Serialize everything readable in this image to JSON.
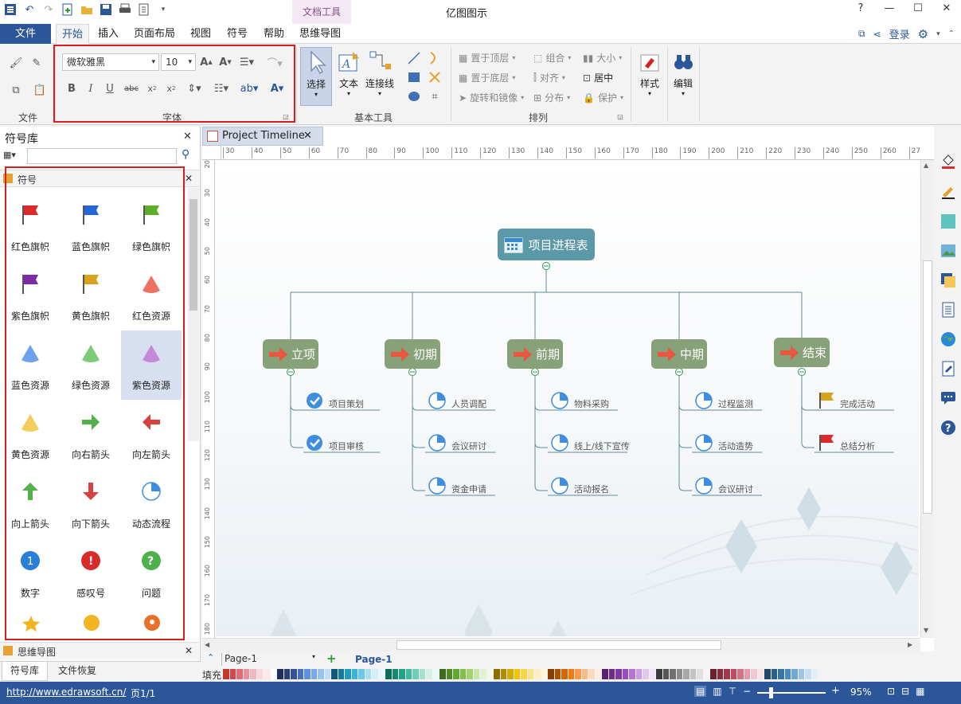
{
  "window": {
    "app_title": "亿图图示",
    "context_tab": "文档工具"
  },
  "menu": {
    "file": "文件",
    "tabs": [
      "开始",
      "插入",
      "页面布局",
      "视图",
      "符号",
      "帮助",
      "思维导图"
    ],
    "login": "登录"
  },
  "ribbon": {
    "file_group": "文件",
    "font_group": "字体",
    "font_name": "微软雅黑",
    "font_size": "10",
    "basic_tools_group": "基本工具",
    "select_label": "选择",
    "text_label": "文本",
    "connector_label": "连接线",
    "arrange_group": "排列",
    "bring_front": "置于顶层",
    "send_back": "置于底层",
    "rotate_mirror": "旋转和镜像",
    "group": "组合",
    "align": "对齐",
    "distribute": "分布",
    "size": "大小",
    "center": "居中",
    "protect": "保护",
    "style_label": "样式",
    "edit_label": "编辑"
  },
  "library": {
    "title": "符号库",
    "section": "符号",
    "search_placeholder": "",
    "symbols": [
      {
        "label": "红色旗帜",
        "icon": "red-flag"
      },
      {
        "label": "蓝色旗帜",
        "icon": "blue-flag"
      },
      {
        "label": "绿色旗帜",
        "icon": "green-flag"
      },
      {
        "label": "紫色旗帜",
        "icon": "purple-flag"
      },
      {
        "label": "黄色旗帜",
        "icon": "yellow-flag"
      },
      {
        "label": "红色资源",
        "icon": "red-cone"
      },
      {
        "label": "蓝色资源",
        "icon": "blue-cone"
      },
      {
        "label": "绿色资源",
        "icon": "green-cone"
      },
      {
        "label": "紫色资源",
        "icon": "purple-cone"
      },
      {
        "label": "黄色资源",
        "icon": "yellow-cone"
      },
      {
        "label": "向右箭头",
        "icon": "arrow-right"
      },
      {
        "label": "向左箭头",
        "icon": "arrow-left"
      },
      {
        "label": "向上箭头",
        "icon": "arrow-up"
      },
      {
        "label": "向下箭头",
        "icon": "arrow-down"
      },
      {
        "label": "动态流程",
        "icon": "pie-progress"
      },
      {
        "label": "数字",
        "icon": "number"
      },
      {
        "label": "感叹号",
        "icon": "exclamation"
      },
      {
        "label": "问题",
        "icon": "question"
      }
    ],
    "bottom_section": "思维导图",
    "bottom_tabs": [
      "符号库",
      "文件恢复"
    ]
  },
  "document": {
    "tab_title": "Project Timeline",
    "page_tab": "Page-1",
    "page_active": "Page-1",
    "fill_label": "填充",
    "ruler_top": [
      "30",
      "40",
      "50",
      "60",
      "70",
      "80",
      "90",
      "100",
      "110",
      "120",
      "130",
      "140",
      "150",
      "160",
      "170",
      "180",
      "190",
      "200",
      "210",
      "220",
      "230",
      "240",
      "250",
      "260",
      "27"
    ],
    "ruler_left": [
      "20",
      "30",
      "40",
      "50",
      "60",
      "70",
      "80",
      "90",
      "100",
      "110",
      "120",
      "130",
      "140",
      "150",
      "160",
      "170",
      "180"
    ]
  },
  "mindmap": {
    "root": "项目进程表",
    "branches": [
      {
        "title": "立项",
        "leaves": [
          {
            "text": "项目策划",
            "icon": "check"
          },
          {
            "text": "项目审核",
            "icon": "check"
          }
        ]
      },
      {
        "title": "初期",
        "leaves": [
          {
            "text": "人员调配",
            "icon": "pie"
          },
          {
            "text": "会议研讨",
            "icon": "pie"
          },
          {
            "text": "资金申请",
            "icon": "pie"
          }
        ]
      },
      {
        "title": "前期",
        "leaves": [
          {
            "text": "物料采购",
            "icon": "pie"
          },
          {
            "text": "线上/线下宣传",
            "icon": "pie"
          },
          {
            "text": "活动报名",
            "icon": "pie"
          }
        ]
      },
      {
        "title": "中期",
        "leaves": [
          {
            "text": "过程监测",
            "icon": "pie"
          },
          {
            "text": "活动造势",
            "icon": "pie"
          },
          {
            "text": "会议研讨",
            "icon": "pie"
          }
        ]
      },
      {
        "title": "结束",
        "leaves": [
          {
            "text": "完成活动",
            "icon": "yellow-flag"
          },
          {
            "text": "总结分析",
            "icon": "red-flag"
          }
        ]
      }
    ]
  },
  "status": {
    "url": "http://www.edrawsoft.cn/",
    "page": "页1/1",
    "zoom": "95%"
  },
  "colors": {
    "accent": "#2b579a",
    "root_node": "#5b99a8",
    "branch_node": "#87a178",
    "line": "#5e8c95",
    "highlight": "#d42020"
  }
}
